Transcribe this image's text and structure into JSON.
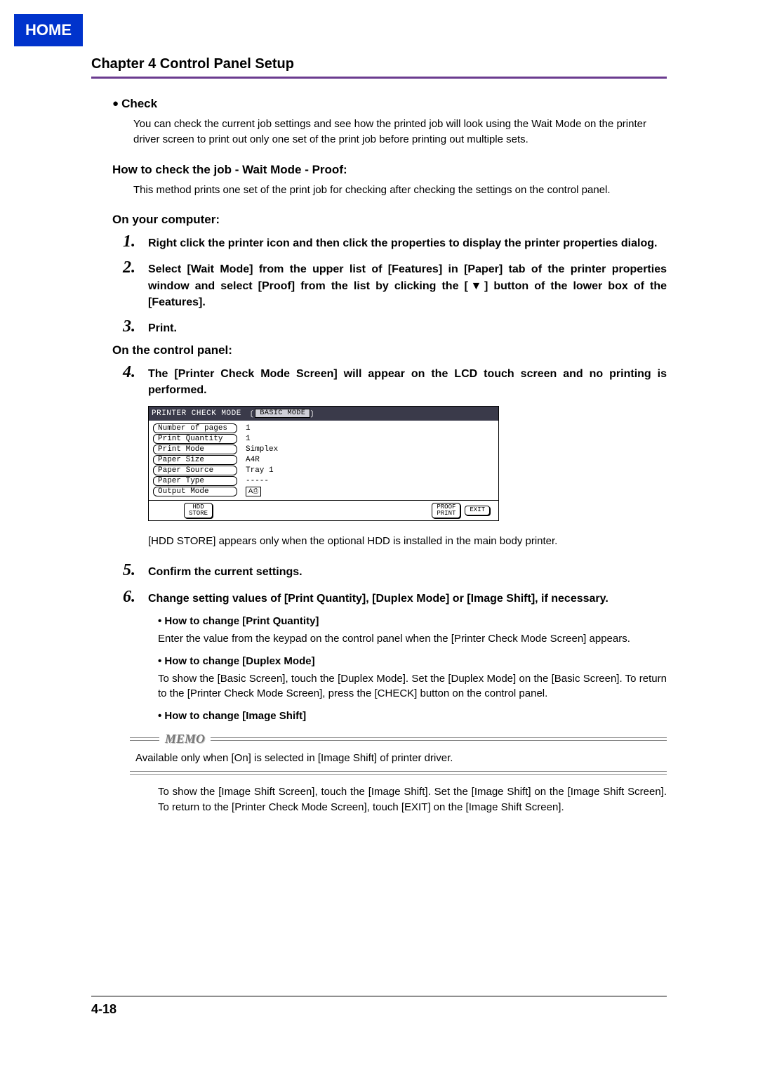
{
  "home_label": "HOME",
  "chapter_title": "Chapter 4 Control Panel Setup",
  "check_heading": "Check",
  "check_body": "You can check the current job settings and see how the printed job will look using the Wait Mode on the printer driver screen to print out only one set of the print job before printing out multiple sets.",
  "howto_heading": "How to check the job - Wait Mode - Proof:",
  "howto_body": "This method prints one set of the print job for checking after checking the settings on the control panel.",
  "on_computer": "On your computer:",
  "on_panel": "On the control panel:",
  "steps": {
    "s1": {
      "n": "1.",
      "t": "Right click the printer icon and then click the properties to display the printer properties dialog."
    },
    "s2": {
      "n": "2.",
      "t": "Select [Wait Mode] from the upper list of [Features] in [Paper] tab of the printer properties window and select [Proof] from the list by clicking the [▼] button of the lower box of the [Features]."
    },
    "s3": {
      "n": "3.",
      "t": "Print."
    },
    "s4": {
      "n": "4.",
      "t": "The [Printer Check Mode Screen] will appear on the LCD touch screen and no printing is performed."
    },
    "s5": {
      "n": "5.",
      "t": "Confirm the current settings."
    },
    "s6": {
      "n": "6.",
      "t": "Change setting values of [Print Quantity], [Duplex Mode] or [Image Shift], if necessary."
    }
  },
  "lcd": {
    "title": "PRINTER CHECK MODE",
    "tab_left": "〔",
    "tab": "BASIC MODE",
    "tab_right": "〕",
    "rows": {
      "r0": {
        "label": "Number of pages",
        "value": "1"
      },
      "r1": {
        "label": "Print Quantity",
        "value": "1"
      },
      "r2": {
        "label": "Print Mode",
        "value": "Simplex"
      },
      "r3": {
        "label": "Paper Size",
        "value": "A4R"
      },
      "r4": {
        "label": "Paper Source",
        "value": "Tray 1"
      },
      "r5": {
        "label": "Paper Type",
        "value": "-----"
      },
      "r6": {
        "label": "Output Mode",
        "value": "A⎙"
      }
    },
    "btn_hdd": "HDD\nSTORE",
    "btn_proof": "PROOF\nPRINT",
    "btn_exit": "EXIT"
  },
  "hdd_note": "[HDD STORE] appears only when the optional HDD is installed in the main body printer.",
  "sub": {
    "pq_h": "How to change [Print Quantity]",
    "pq_b": "Enter the value from the keypad on the control panel when the [Printer Check Mode Screen] appears.",
    "dm_h": "How to change [Duplex Mode]",
    "dm_b": "To show the [Basic Screen], touch the [Duplex Mode]. Set the [Duplex Mode] on the [Basic Screen]. To return to the [Printer Check Mode Screen], press the [CHECK] button on the control panel.",
    "is_h": "How to change [Image Shift]",
    "is_b": "To show the [Image Shift Screen], touch the [Image Shift]. Set the [Image Shift] on the [Image Shift Screen]. To return to the [Printer Check Mode Screen], touch [EXIT] on the [Image Shift Screen]."
  },
  "memo_label": "MEMO",
  "memo_text": "Available only when [On] is selected in [Image Shift] of printer driver.",
  "page_number": "4-18"
}
